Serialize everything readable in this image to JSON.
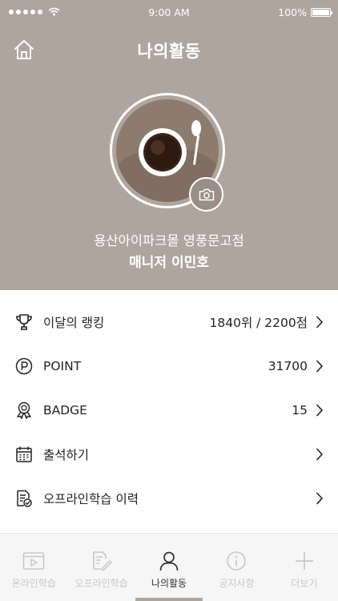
{
  "status_bar": {
    "time": "9:00 AM",
    "battery": "100%"
  },
  "header": {
    "title": "나의활동"
  },
  "profile": {
    "store": "용산아이파크몰 영풍문고점",
    "name": "매니저 이민호"
  },
  "menu": [
    {
      "icon": "trophy-icon",
      "label": "이달의 랭킹",
      "value": "1840위 / 2200점"
    },
    {
      "icon": "point-icon",
      "label": "POINT",
      "value": "31700"
    },
    {
      "icon": "badge-icon",
      "label": "BADGE",
      "value": "15"
    },
    {
      "icon": "calendar-icon",
      "label": "출석하기",
      "value": ""
    },
    {
      "icon": "document-check-icon",
      "label": "오프라인학습 이력",
      "value": ""
    }
  ],
  "tabs": [
    {
      "icon": "video-icon",
      "label": "온라인학습",
      "active": false
    },
    {
      "icon": "edit-document-icon",
      "label": "오프라인학습",
      "active": false
    },
    {
      "icon": "person-icon",
      "label": "나의활동",
      "active": true
    },
    {
      "icon": "info-icon",
      "label": "공지사항",
      "active": false
    },
    {
      "icon": "plus-icon",
      "label": "더보기",
      "active": false
    }
  ],
  "colors": {
    "header_bg": "#aea69e",
    "active_tab": "#333333",
    "inactive_tab": "#c7c7c7"
  }
}
